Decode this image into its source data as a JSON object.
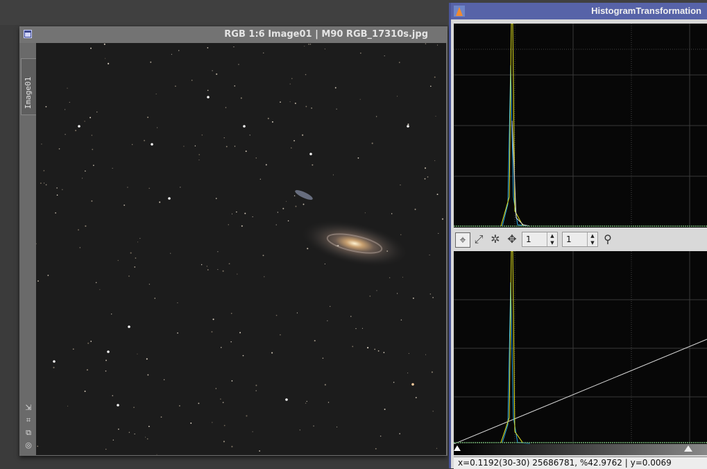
{
  "image_window": {
    "title": "RGB 1:6 Image01 | M90 RGB_17310s.jpg",
    "tab_label": "Image01",
    "side_icons": [
      "resize-icon",
      "fit-icon",
      "clone-icon",
      "target-icon"
    ]
  },
  "histogram_window": {
    "title": "HistogramTransformation",
    "toolbar": {
      "spin1": "1",
      "spin2": "1"
    },
    "status": "x=0.1192(30-30) 25686781, %42.9762 | y=0.0069"
  },
  "colors": {
    "histogram_title_bar": "#5763a8",
    "red_green_peak": "#e8e820",
    "blue_peak": "#2aa8e8",
    "image_title_bar": "#737373"
  }
}
